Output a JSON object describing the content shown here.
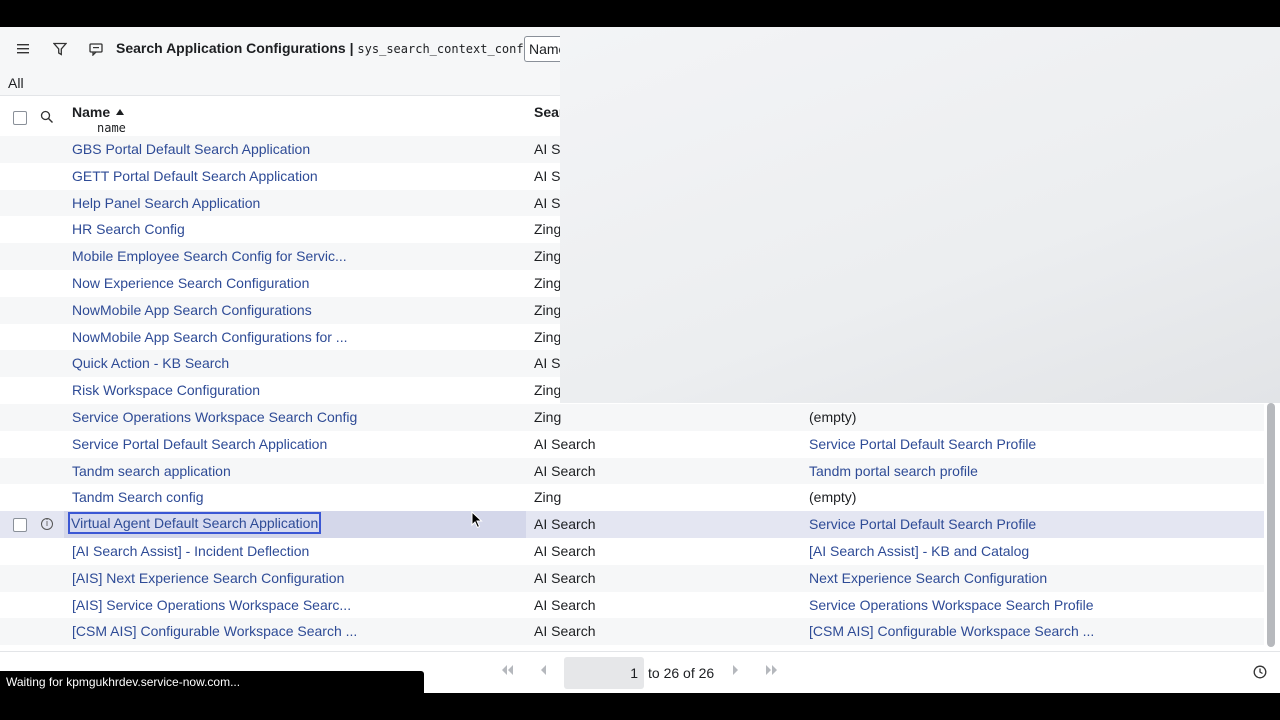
{
  "header": {
    "title": "Search Application Configurations |",
    "table": "sys_search_context_config",
    "search_field_value": "Name"
  },
  "filter_bar": {
    "label": "All"
  },
  "columns": {
    "name": {
      "label": "Name",
      "field": "name"
    },
    "engine": {
      "label": "Sear"
    }
  },
  "rows": [
    {
      "name": "GBS Portal Default Search Application",
      "engine": "AI Se",
      "profile": ""
    },
    {
      "name": "GETT Portal Default Search Application",
      "engine": "AI Se",
      "profile": ""
    },
    {
      "name": "Help Panel Search Application",
      "engine": "AI Se",
      "profile": ""
    },
    {
      "name": "HR Search Config",
      "engine": "Zing",
      "profile": ""
    },
    {
      "name": "Mobile Employee Search Config for Servic...",
      "engine": "Zing",
      "profile": ""
    },
    {
      "name": "Now Experience Search Configuration",
      "engine": "Zing",
      "profile": ""
    },
    {
      "name": "NowMobile App Search Configurations",
      "engine": "Zing",
      "profile": ""
    },
    {
      "name": "NowMobile App Search Configurations for ...",
      "engine": "Zing",
      "profile": ""
    },
    {
      "name": "Quick Action - KB Search",
      "engine": "AI Se",
      "profile": ""
    },
    {
      "name": "Risk Workspace Configuration",
      "engine": "Zing",
      "profile": ""
    },
    {
      "name": "Service Operations Workspace Search Config",
      "engine": "Zing",
      "profile": "(empty)"
    },
    {
      "name": "Service Portal Default Search Application",
      "engine": "AI Search",
      "profile": "Service Portal Default Search Profile"
    },
    {
      "name": "Tandm search application",
      "engine": "AI Search",
      "profile": "Tandm portal search profile"
    },
    {
      "name": "Tandm Search config",
      "engine": "Zing",
      "profile": "(empty)"
    },
    {
      "name": "Virtual Agent Default Search Application",
      "engine": "AI Search",
      "profile": "Service Portal Default Search Profile"
    },
    {
      "name": "[AI Search Assist] - Incident Deflection",
      "engine": "AI Search",
      "profile": "[AI Search Assist] - KB and Catalog"
    },
    {
      "name": "[AIS] Next Experience Search Configuration",
      "engine": "AI Search",
      "profile": "Next Experience Search Configuration"
    },
    {
      "name": "[AIS] Service Operations Workspace Searc...",
      "engine": "AI Search",
      "profile": "Service Operations Workspace Search Profile"
    },
    {
      "name": "[CSM AIS] Configurable Workspace Search ...",
      "engine": "AI Search",
      "profile": "[CSM AIS] Configurable Workspace Search ..."
    }
  ],
  "pagination": {
    "current": "1",
    "range_text": "to 26 of 26"
  },
  "status_bar": {
    "text": "Waiting for kpmgukhrdev.service-now.com..."
  },
  "colors": {
    "link": "#2e4b96",
    "selection_outline": "#3b57d4",
    "row_alt": "#f6f7f8"
  },
  "icons": [
    "menu-icon",
    "filter-icon",
    "comment-icon",
    "search-icon",
    "info-icon",
    "first-page-icon",
    "prev-page-icon",
    "next-page-icon",
    "last-page-icon",
    "clock-icon",
    "mouse-cursor-icon"
  ]
}
